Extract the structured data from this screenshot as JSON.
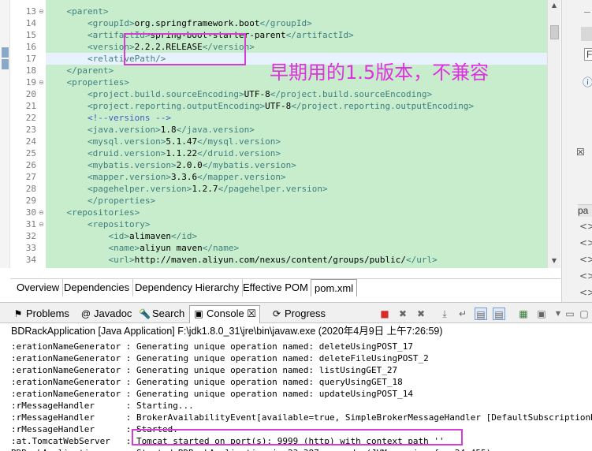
{
  "editor": {
    "lines": [
      {
        "n": "13",
        "fold": "⊖",
        "parts": [
          {
            "c": "t",
            "s": "    <parent>"
          }
        ]
      },
      {
        "n": "14",
        "fold": "",
        "parts": [
          {
            "c": "t",
            "s": "        <groupId>"
          },
          {
            "c": "v",
            "s": "org.springframework.boot"
          },
          {
            "c": "t",
            "s": "</groupId>"
          }
        ]
      },
      {
        "n": "15",
        "fold": "",
        "parts": [
          {
            "c": "t",
            "s": "        <artifactId>"
          },
          {
            "c": "v",
            "s": "spring-boot-starter-parent"
          },
          {
            "c": "t",
            "s": "</artifactId>"
          }
        ]
      },
      {
        "n": "16",
        "fold": "",
        "parts": [
          {
            "c": "t",
            "s": "        <version>"
          },
          {
            "c": "v",
            "s": "2.2.2.RELEASE"
          },
          {
            "c": "t",
            "s": "</version>"
          }
        ]
      },
      {
        "n": "17",
        "fold": "",
        "current": true,
        "parts": [
          {
            "c": "t",
            "s": "        <relativePath/>"
          }
        ]
      },
      {
        "n": "18",
        "fold": "",
        "parts": [
          {
            "c": "t",
            "s": "    </parent>"
          }
        ]
      },
      {
        "n": "19",
        "fold": "⊖",
        "parts": [
          {
            "c": "t",
            "s": "    <properties>"
          }
        ]
      },
      {
        "n": "20",
        "fold": "",
        "parts": [
          {
            "c": "t",
            "s": "        <project.build.sourceEncoding>"
          },
          {
            "c": "v",
            "s": "UTF-8"
          },
          {
            "c": "t",
            "s": "</project.build.sourceEncoding>"
          }
        ]
      },
      {
        "n": "21",
        "fold": "",
        "parts": [
          {
            "c": "t",
            "s": "        <project.reporting.outputEncoding>"
          },
          {
            "c": "v",
            "s": "UTF-8"
          },
          {
            "c": "t",
            "s": "</project.reporting.outputEncoding>"
          }
        ]
      },
      {
        "n": "22",
        "fold": "",
        "parts": [
          {
            "c": "c",
            "s": "        <!--versions -->"
          }
        ]
      },
      {
        "n": "23",
        "fold": "",
        "parts": [
          {
            "c": "t",
            "s": "        <java.version>"
          },
          {
            "c": "v",
            "s": "1.8"
          },
          {
            "c": "t",
            "s": "</java.version>"
          }
        ]
      },
      {
        "n": "24",
        "fold": "",
        "parts": [
          {
            "c": "t",
            "s": "        <mysql.version>"
          },
          {
            "c": "v",
            "s": "5.1.47"
          },
          {
            "c": "t",
            "s": "</mysql.version>"
          }
        ]
      },
      {
        "n": "25",
        "fold": "",
        "parts": [
          {
            "c": "t",
            "s": "        <druid.version>"
          },
          {
            "c": "v",
            "s": "1.1.22"
          },
          {
            "c": "t",
            "s": "</druid.version>"
          }
        ]
      },
      {
        "n": "26",
        "fold": "",
        "parts": [
          {
            "c": "t",
            "s": "        <mybatis.version>"
          },
          {
            "c": "v",
            "s": "2.0.0"
          },
          {
            "c": "t",
            "s": "</mybatis.version>"
          }
        ]
      },
      {
        "n": "27",
        "fold": "",
        "parts": [
          {
            "c": "t",
            "s": "        <mapper.version>"
          },
          {
            "c": "v",
            "s": "3.3.6"
          },
          {
            "c": "t",
            "s": "</mapper.version>"
          }
        ]
      },
      {
        "n": "28",
        "fold": "",
        "parts": [
          {
            "c": "t",
            "s": "        <pagehelper.version>"
          },
          {
            "c": "v",
            "s": "1.2.7"
          },
          {
            "c": "t",
            "s": "</pagehelper.version>"
          }
        ]
      },
      {
        "n": "29",
        "fold": "",
        "parts": [
          {
            "c": "t",
            "s": "        </properties>"
          }
        ]
      },
      {
        "n": "30",
        "fold": "⊖",
        "parts": [
          {
            "c": "t",
            "s": "    <repositories>"
          }
        ]
      },
      {
        "n": "31",
        "fold": "⊖",
        "parts": [
          {
            "c": "t",
            "s": "        <repository>"
          }
        ]
      },
      {
        "n": "32",
        "fold": "",
        "parts": [
          {
            "c": "t",
            "s": "            <id>"
          },
          {
            "c": "v",
            "s": "alimaven"
          },
          {
            "c": "t",
            "s": "</id>"
          }
        ]
      },
      {
        "n": "33",
        "fold": "",
        "parts": [
          {
            "c": "t",
            "s": "            <name>"
          },
          {
            "c": "v",
            "s": "aliyun maven"
          },
          {
            "c": "t",
            "s": "</name>"
          }
        ]
      },
      {
        "n": "34",
        "fold": "",
        "parts": [
          {
            "c": "t",
            "s": "            <url>"
          },
          {
            "c": "v",
            "s": "http://maven.aliyun.com/nexus/content/groups/public/"
          },
          {
            "c": "t",
            "s": "</url>"
          }
        ]
      }
    ],
    "annotation": "早期用的1.5版本，不兼容",
    "tabs": [
      "Overview",
      "Dependencies",
      "Dependency Hierarchy",
      "Effective POM",
      "pom.xml"
    ],
    "active_tab": "pom.xml"
  },
  "right_panel": {
    "items": [
      "F",
      "ⓘ",
      "☒",
      "pa"
    ],
    "outline": [
      "<>",
      "<>",
      "<>",
      "<>",
      "<>",
      "<>"
    ]
  },
  "console": {
    "tabs": [
      {
        "label": "Problems",
        "icon": "problems-icon",
        "glyph": "⚑"
      },
      {
        "label": "Javadoc",
        "icon": "javadoc-icon",
        "glyph": "@"
      },
      {
        "label": "Search",
        "icon": "search-icon",
        "glyph": "🔦"
      },
      {
        "label": "Console ☒",
        "icon": "console-icon",
        "glyph": "▣"
      },
      {
        "label": "Progress",
        "icon": "progress-icon",
        "glyph": "⟳"
      }
    ],
    "active_tab": "Console ☒",
    "header": "BDRackApplication [Java Application] F:\\jdk1.8.0_31\\jre\\bin\\javaw.exe (2020年4月9日 上午7:26:59)",
    "lines": [
      ":erationNameGenerator : Generating unique operation named: deleteUsingPOST_17",
      ":erationNameGenerator : Generating unique operation named: deleteFileUsingPOST_2",
      ":erationNameGenerator : Generating unique operation named: listUsingGET_27",
      ":erationNameGenerator : Generating unique operation named: queryUsingGET_18",
      ":erationNameGenerator : Generating unique operation named: updateUsingPOST_14",
      ":rMessageHandler      : Starting...",
      ":rMessageHandler      : BrokerAvailabilityEvent[available=true, SimpleBrokerMessageHandler [DefaultSubscriptionRegistry",
      ":rMessageHandler      : Started.",
      ":at.TomcatWebServer   : Tomcat started on port(s): 9999 (http) with context path ''",
      "BDRackApplication     : Started BDRackApplication in 23.387 seconds (JVM running for 24.455)"
    ],
    "toolbar_icons": [
      "terminate-icon",
      "remove-launch-icon",
      "remove-all-icon",
      "scroll-lock-icon",
      "word-wrap-icon",
      "show-on-output-icon",
      "show-on-error-icon",
      "pin-console-icon",
      "display-selected-icon",
      "open-console-icon",
      "minimize-icon",
      "maximize-icon"
    ]
  },
  "colors": {
    "editor_bg": "#c7edcc",
    "tag": "#3f7f7f",
    "comment": "#3f5fbf",
    "annotation": "#e02fe0"
  }
}
